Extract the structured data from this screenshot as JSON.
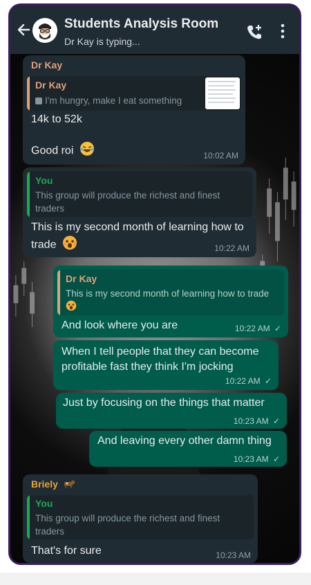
{
  "header": {
    "title": "Students Analysis Room",
    "subtitle": "Dr Kay is typing..."
  },
  "messages": [
    {
      "sender": "Dr Kay",
      "quote_name": "Dr Kay",
      "quote_text": "I'm hungry, make I eat something",
      "lines": [
        "14k to 52k",
        "Good roi"
      ],
      "time": "10:02 AM"
    },
    {
      "quote_name": "You",
      "quote_text": "This group will produce the richest and finest traders",
      "text": "This is my second month of learning how to trade",
      "time": "10:22 AM"
    },
    {
      "quote_name": "Dr Kay",
      "quote_text": "This is my second month of learning how to trade",
      "text": "And look where you are",
      "time": "10:22 AM"
    },
    {
      "text": "When I tell people that they can become profitable fast they think I'm jocking",
      "time": "10:22 AM"
    },
    {
      "text": "Just by focusing on the things that matter",
      "time": "10:23 AM"
    },
    {
      "text": "And leaving every other damn thing",
      "time": "10:23 AM"
    },
    {
      "sender": "Briely",
      "quote_name": "You",
      "quote_text": "This group will produce the richest and finest traders",
      "text": "That's for sure",
      "time": "10:23 AM"
    }
  ],
  "colors": {
    "header_bg": "#1f2c34",
    "incoming_bubble": "#202c33",
    "outgoing_bubble": "#005c4b",
    "drkay_name": "#e2a07a",
    "you_name": "#1fa855",
    "briely_name": "#e6a23c"
  }
}
